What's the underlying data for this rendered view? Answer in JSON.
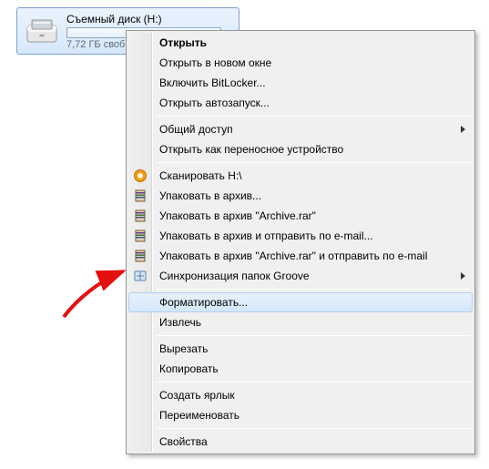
{
  "drive": {
    "name": "Съемный диск (H:)",
    "status": "7,72 ГБ своб"
  },
  "menu": {
    "open": "Открыть",
    "open_new_window": "Открыть в новом окне",
    "bitlocker": "Включить BitLocker...",
    "autorun": "Открыть автозапуск...",
    "sharing": "Общий доступ",
    "open_portable": "Открыть как переносное устройство",
    "scan": "Сканировать H:\\",
    "pack_archive": "Упаковать в архив...",
    "pack_archive_rar": "Упаковать в архив \"Archive.rar\"",
    "pack_send": "Упаковать в архив и отправить по e-mail...",
    "pack_rar_send": "Упаковать в архив \"Archive.rar\" и отправить по e-mail",
    "groove_sync": "Синхронизация папок Groove",
    "format": "Форматировать...",
    "eject": "Извлечь",
    "cut": "Вырезать",
    "copy": "Копировать",
    "shortcut": "Создать ярлык",
    "rename": "Переименовать",
    "properties": "Свойства"
  },
  "colors": {
    "selection_border": "#7da2ce",
    "hover_border": "#aecff7",
    "arrow": "#e40f0f"
  }
}
